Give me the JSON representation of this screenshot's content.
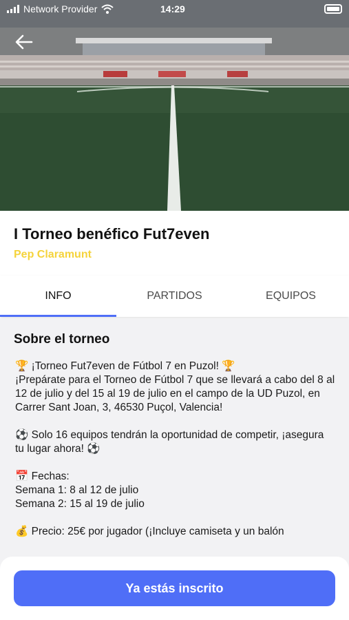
{
  "status_bar": {
    "carrier": "Network Provider",
    "time": "14:29"
  },
  "event": {
    "title": "I Torneo benéfico Fut7even",
    "organizer": "Pep Claramunt"
  },
  "tabs": [
    {
      "label": "INFO",
      "active": true
    },
    {
      "label": "PARTIDOS",
      "active": false
    },
    {
      "label": "EQUIPOS",
      "active": false
    }
  ],
  "about": {
    "heading": "Sobre el torneo",
    "lines": [
      "🏆 ¡Torneo Fut7even de Fútbol 7 en Puzol! 🏆",
      "¡Prepárate para el Torneo de Fútbol 7 que se llevará a cabo del 8 al 12 de julio y del 15 al 19 de julio en el campo de la UD Puzol, en Carrer Sant Joan, 3, 46530 Puçol, Valencia!",
      "⚽ Solo 16 equipos tendrán la oportunidad de competir, ¡asegura tu lugar ahora! ⚽",
      "📅 Fechas:",
      "Semana 1: 8 al 12 de julio",
      "Semana 2: 15 al 19 de julio",
      "💰 Precio: 25€ por jugador (¡Incluye camiseta y un balón"
    ]
  },
  "cta": {
    "label": "Ya estás inscrito"
  },
  "colors": {
    "accent": "#4f6ef7",
    "organizer": "#f5d33b"
  }
}
